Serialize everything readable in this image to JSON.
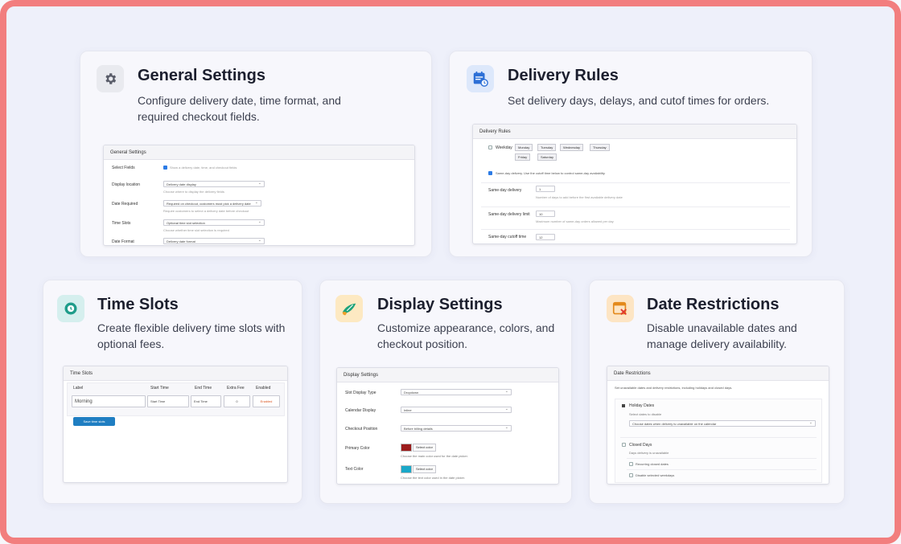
{
  "cards": [
    {
      "icon": "gear-icon",
      "title": "General Settings",
      "description": "Configure delivery date, time format, and required checkout fields.",
      "screenshot": {
        "header": "General Settings",
        "rows": [
          {
            "label": "Select Fields",
            "value": "Show a delivery date, time, and checkout fields"
          },
          {
            "label": "Display location",
            "value": "Delivery date display",
            "help": "Choose where to display the delivery fields"
          },
          {
            "label": "Date Required",
            "value": "Required on checkout, customers must pick a delivery date",
            "help": "Require customers to select a delivery date before checkout"
          },
          {
            "label": "Time Slots",
            "value": "Optional time slot selection",
            "help": "Choose whether time slot selection is required"
          },
          {
            "label": "Date Format",
            "value": "Delivery date format",
            "help": "Choose date format"
          }
        ]
      }
    },
    {
      "icon": "calendar-clock-icon",
      "title": "Delivery Rules",
      "description": "Set delivery days, delays, and cutof times for orders.",
      "screenshot": {
        "header": "Delivery Rules",
        "weekday_label": "Weekday",
        "days": [
          "Monday",
          "Tuesday",
          "Wednesday",
          "Thursday",
          "Friday",
          "Saturday"
        ],
        "sameday_text": "Same-day delivery. Use the cutoff time below to control same-day availability.",
        "rows": [
          {
            "label": "Same-day delivery",
            "value": "1",
            "help": "Number of days to add before the first available delivery date"
          },
          {
            "label": "Same-day delivery limit",
            "value": "10",
            "help": "Maximum number of same-day orders allowed per day"
          },
          {
            "label": "Same-day cutoff time",
            "value": "12"
          }
        ]
      }
    },
    {
      "icon": "clock-icon",
      "title": "Time Slots",
      "description": "Create flexible delivery time slots with optional fees.",
      "screenshot": {
        "header": "Time Slots",
        "columns": [
          "Label",
          "Start Time",
          "End Time",
          "Extra Fee",
          "Enabled"
        ],
        "row": {
          "label": "Morning",
          "start": "Start Time",
          "end": "End Time",
          "fee": "0",
          "enabled": "Enabled"
        },
        "button": "Save time slots"
      }
    },
    {
      "icon": "paint-brush-icon",
      "title": "Display Settings",
      "description": "Customize appearance, colors, and checkout position.",
      "screenshot": {
        "header": "Display Settings",
        "rows": [
          {
            "label": "Slot Display Type",
            "value": "Dropdown"
          },
          {
            "label": "Calendar Display",
            "value": "Inline"
          },
          {
            "label": "Checkout Position",
            "value": "Before billing details"
          },
          {
            "label": "Primary Color",
            "value": "#9b1c1c",
            "button": "Select color",
            "help": "Choose the main color used for the date picker."
          },
          {
            "label": "Text Color",
            "value": "#1aa8c8",
            "button": "Select color",
            "help": "Choose the text color used in the date picker."
          }
        ]
      }
    },
    {
      "icon": "calendar-x-icon",
      "title": "Date Restrictions",
      "description": "Disable unavailable dates and manage delivery availability.",
      "screenshot": {
        "header": "Date Restrictions",
        "intro": "Set unavailable dates and delivery restrictions, including holidays and closed days.",
        "section1_title": "Holiday Dates",
        "section1_sub": "Select dates to disable",
        "section1_field": "Choose dates when delivery is unavailable on the calendar",
        "section2_title": "Closed Days",
        "section2_sub": "Days delivery is unavailable",
        "item1": "Recurring closed dates",
        "item2": "Disable selected weekdays"
      }
    }
  ],
  "colors": {
    "frame": "#f27e7e",
    "background": "#eef0fa",
    "primary_swatch": "#9b1c1c",
    "text_swatch": "#1aa8c8",
    "save_button": "#1f7ec2"
  }
}
